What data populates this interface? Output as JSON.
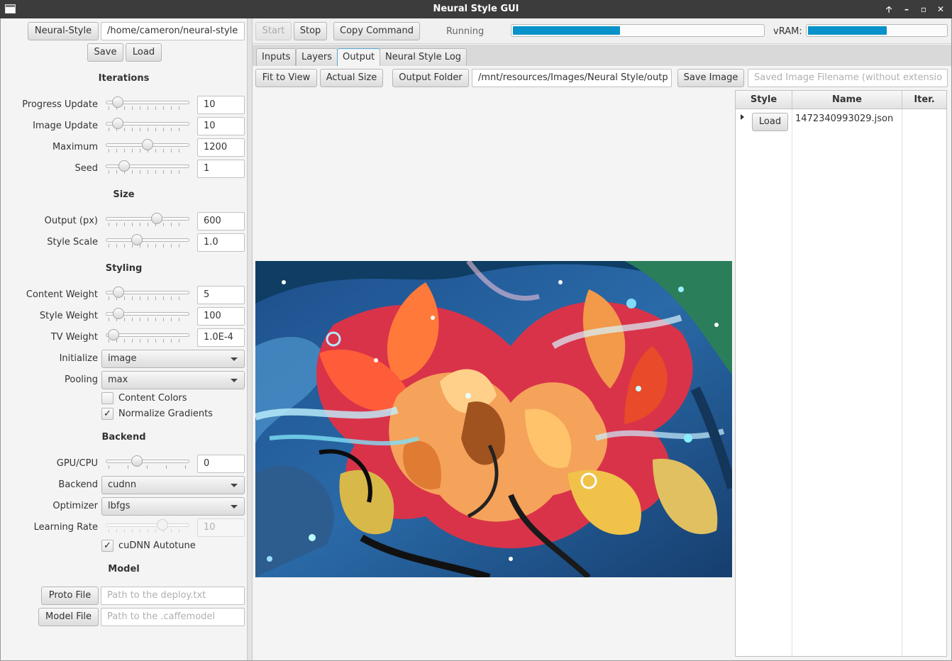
{
  "window": {
    "title": "Neural Style GUI"
  },
  "left": {
    "neural_style_button": "Neural-Style",
    "neural_style_path": "/home/cameron/neural-style",
    "save_button": "Save",
    "load_button": "Load",
    "iterations": {
      "heading": "Iterations",
      "progress_update": {
        "label": "Progress Update",
        "value": "10",
        "slider_fraction": 0.1
      },
      "image_update": {
        "label": "Image Update",
        "value": "10",
        "slider_fraction": 0.1
      },
      "maximum": {
        "label": "Maximum",
        "value": "1200",
        "slider_fraction": 0.5
      },
      "seed": {
        "label": "Seed",
        "value": "1",
        "slider_fraction": 0.19
      }
    },
    "size": {
      "heading": "Size",
      "output_px": {
        "label": "Output (px)",
        "value": "600",
        "slider_fraction": 0.62
      },
      "style_scale": {
        "label": "Style Scale",
        "value": "1.0",
        "slider_fraction": 0.36
      }
    },
    "styling": {
      "heading": "Styling",
      "content_weight": {
        "label": "Content Weight",
        "value": "5",
        "slider_fraction": 0.11
      },
      "style_weight": {
        "label": "Style Weight",
        "value": "100",
        "slider_fraction": 0.11
      },
      "tv_weight": {
        "label": "TV Weight",
        "value": "1.0E-4",
        "slider_fraction": 0.05
      },
      "initialize": {
        "label": "Initialize",
        "value": "image"
      },
      "pooling": {
        "label": "Pooling",
        "value": "max"
      },
      "content_colors": {
        "label": "Content Colors",
        "checked": false
      },
      "normalize_gradients": {
        "label": "Normalize Gradients",
        "checked": true,
        "mark": "✓"
      }
    },
    "backend": {
      "heading": "Backend",
      "gpu_cpu": {
        "label": "GPU/CPU",
        "value": "0",
        "slider_fraction": 0.36
      },
      "backend": {
        "label": "Backend",
        "value": "cudnn"
      },
      "optimizer": {
        "label": "Optimizer",
        "value": "lbfgs"
      },
      "learning_rate": {
        "label": "Learning Rate",
        "value": "10",
        "slider_fraction": 0.7
      },
      "cudnn_autotune": {
        "label": "cuDNN Autotune",
        "checked": true,
        "mark": "✓"
      }
    },
    "model": {
      "heading": "Model",
      "proto_button": "Proto File",
      "proto_placeholder": "Path to the deploy.txt",
      "model_button": "Model File",
      "model_placeholder": "Path to the .caffemodel"
    }
  },
  "toolbar": {
    "start": "Start",
    "stop": "Stop",
    "copy_command": "Copy Command",
    "status": "Running",
    "progress_fraction": 0.43,
    "vram_label": "vRAM:",
    "vram_fraction": 0.58
  },
  "tabs": [
    "Inputs",
    "Layers",
    "Output",
    "Neural Style Log"
  ],
  "active_tab": "Output",
  "output": {
    "fit_to_view": "Fit to View",
    "actual_size": "Actual Size",
    "output_folder": "Output Folder",
    "output_path": "/mnt/resources/Images/Neural Style/outp",
    "save_image": "Save Image",
    "filename_placeholder": "Saved Image Filename (without extensio",
    "table": {
      "headers": [
        "Style",
        "Name",
        "Iter."
      ],
      "rows": [
        {
          "load": "Load",
          "name": "1472340993029.json"
        }
      ]
    }
  },
  "colors": {
    "accent": "#0892c9",
    "titlebar": "#3c3c3c"
  },
  "icons": [
    "app-icon",
    "maximize-up-icon",
    "minimize-icon",
    "restore-icon",
    "close-icon",
    "dropdown-arrow-icon",
    "check-icon",
    "tree-expand-icon"
  ]
}
